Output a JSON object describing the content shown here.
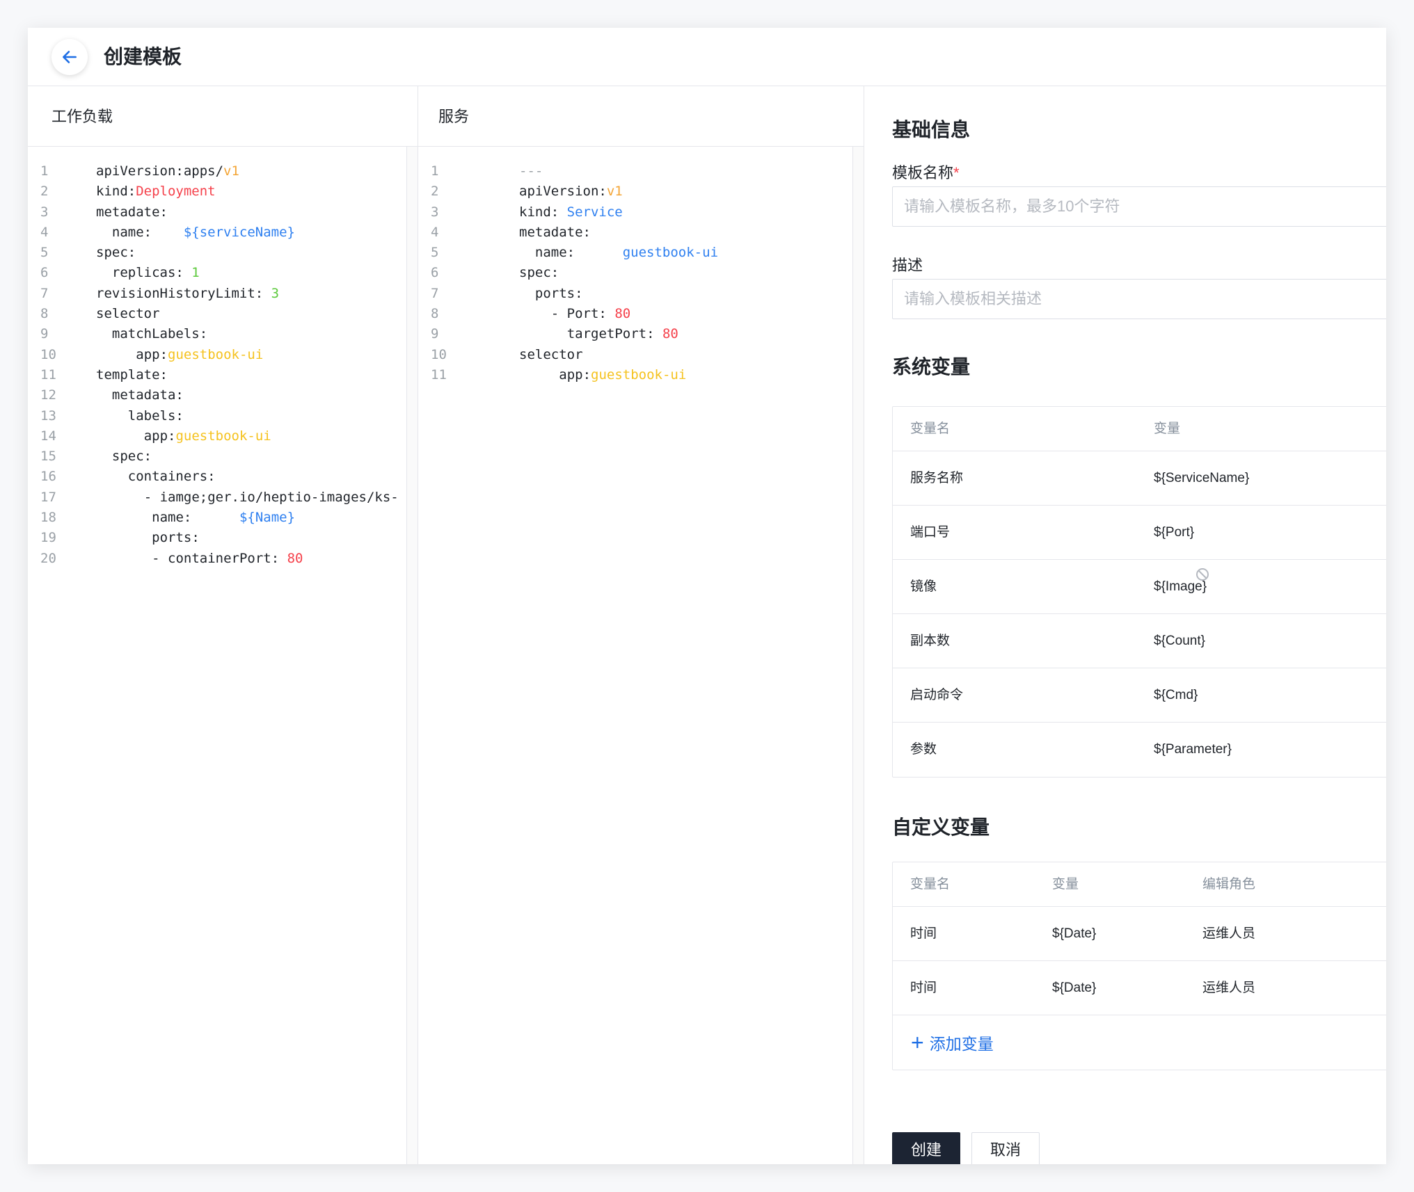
{
  "header": {
    "title": "创建模板"
  },
  "workload": {
    "title": "工作负载",
    "lines": [
      {
        "no": "1",
        "indent": 0,
        "parts": [
          {
            "t": "apiVersion:apps/"
          },
          {
            "t": "v1",
            "c": "orange"
          }
        ]
      },
      {
        "no": "2",
        "indent": 0,
        "parts": [
          {
            "t": "kind:"
          },
          {
            "t": "Deployment",
            "c": "red"
          }
        ]
      },
      {
        "no": "3",
        "indent": 0,
        "parts": [
          {
            "t": "metadate:"
          }
        ]
      },
      {
        "no": "4",
        "indent": 2,
        "parts": [
          {
            "t": "name:    "
          },
          {
            "t": "${serviceName}",
            "c": "blue"
          }
        ]
      },
      {
        "no": "5",
        "indent": 0,
        "parts": [
          {
            "t": "spec:"
          }
        ]
      },
      {
        "no": "6",
        "indent": 2,
        "parts": [
          {
            "t": "replicas: "
          },
          {
            "t": "1",
            "c": "green"
          }
        ]
      },
      {
        "no": "7",
        "indent": 0,
        "parts": [
          {
            "t": "revisionHistoryLimit: "
          },
          {
            "t": "3",
            "c": "green"
          }
        ]
      },
      {
        "no": "8",
        "indent": 0,
        "parts": [
          {
            "t": "selector"
          }
        ]
      },
      {
        "no": "9",
        "indent": 2,
        "parts": [
          {
            "t": "matchLabels:"
          }
        ]
      },
      {
        "no": "10",
        "indent": 5,
        "parts": [
          {
            "t": "app:"
          },
          {
            "t": "guestbook-ui",
            "c": "yellow"
          }
        ]
      },
      {
        "no": "11",
        "indent": 0,
        "parts": [
          {
            "t": "template:"
          }
        ]
      },
      {
        "no": "12",
        "indent": 2,
        "parts": [
          {
            "t": "metadata:"
          }
        ]
      },
      {
        "no": "13",
        "indent": 4,
        "parts": [
          {
            "t": "labels:"
          }
        ]
      },
      {
        "no": "14",
        "indent": 6,
        "parts": [
          {
            "t": "app:"
          },
          {
            "t": "guestbook-ui",
            "c": "yellow"
          }
        ]
      },
      {
        "no": "15",
        "indent": 2,
        "parts": [
          {
            "t": "spec:"
          }
        ]
      },
      {
        "no": "16",
        "indent": 4,
        "parts": [
          {
            "t": "containers:"
          }
        ]
      },
      {
        "no": "17",
        "indent": 6,
        "parts": [
          {
            "t": "- iamge;ger.io/heptio-images/ks-"
          }
        ]
      },
      {
        "no": "18",
        "indent": 7,
        "parts": [
          {
            "t": "name:      "
          },
          {
            "t": "${Name}",
            "c": "blue"
          }
        ]
      },
      {
        "no": "19",
        "indent": 7,
        "parts": [
          {
            "t": "ports:"
          }
        ]
      },
      {
        "no": "20",
        "indent": 7,
        "parts": [
          {
            "t": "- containerPort: "
          },
          {
            "t": "80",
            "c": "red"
          }
        ]
      }
    ]
  },
  "service": {
    "title": "服务",
    "lines": [
      {
        "no": "1",
        "indent": 0,
        "parts": [
          {
            "t": "---",
            "c": "gray"
          }
        ]
      },
      {
        "no": "2",
        "indent": 0,
        "parts": [
          {
            "t": "apiVersion:"
          },
          {
            "t": "v1",
            "c": "orange"
          }
        ]
      },
      {
        "no": "3",
        "indent": 0,
        "parts": [
          {
            "t": "kind: "
          },
          {
            "t": "Service",
            "c": "blue"
          }
        ]
      },
      {
        "no": "4",
        "indent": 0,
        "parts": [
          {
            "t": "metadate:"
          }
        ]
      },
      {
        "no": "5",
        "indent": 2,
        "parts": [
          {
            "t": "name:      "
          },
          {
            "t": "guestbook-ui",
            "c": "blue"
          }
        ]
      },
      {
        "no": "6",
        "indent": 0,
        "parts": [
          {
            "t": "spec:"
          }
        ]
      },
      {
        "no": "7",
        "indent": 2,
        "parts": [
          {
            "t": "ports:"
          }
        ]
      },
      {
        "no": "8",
        "indent": 4,
        "parts": [
          {
            "t": "- Port: "
          },
          {
            "t": "80",
            "c": "red"
          }
        ]
      },
      {
        "no": "9",
        "indent": 6,
        "parts": [
          {
            "t": "targetPort: "
          },
          {
            "t": "80",
            "c": "red"
          }
        ]
      },
      {
        "no": "10",
        "indent": 0,
        "parts": [
          {
            "t": "selector"
          }
        ]
      },
      {
        "no": "11",
        "indent": 5,
        "parts": [
          {
            "t": "app:"
          },
          {
            "t": "guestbook-ui",
            "c": "yellow"
          }
        ]
      }
    ]
  },
  "basic_info": {
    "title": "基础信息",
    "template_name_label": "模板名称",
    "required_mark": "*",
    "template_name_placeholder": "请输入模板名称，最多10个字符",
    "template_name_value": "",
    "description_label": "描述",
    "description_placeholder": "请输入模板相关描述",
    "description_value": ""
  },
  "system_vars": {
    "title": "系统变量",
    "columns": [
      "变量名",
      "变量"
    ],
    "rows": [
      [
        "服务名称",
        "${ServiceName}"
      ],
      [
        "端口号",
        "${Port}"
      ],
      [
        "镜像",
        "${Image}"
      ],
      [
        "副本数",
        "${Count}"
      ],
      [
        "启动命令",
        "${Cmd}"
      ],
      [
        "参数",
        "${Parameter}"
      ]
    ]
  },
  "custom_vars": {
    "title": "自定义变量",
    "columns": [
      "变量名",
      "变量",
      "编辑角色"
    ],
    "rows": [
      [
        "时间",
        "${Date}",
        "运维人员"
      ],
      [
        "时间",
        "${Date}",
        "运维人员"
      ]
    ],
    "add_label": "添加变量"
  },
  "actions": {
    "create_label": "创建",
    "cancel_label": "取消"
  },
  "colors": {
    "accent": "#1f6fe5",
    "primary_button": "#1c2433",
    "orange": "#f3a536",
    "red": "#f5414b",
    "blue": "#2f80f0",
    "green": "#5cc93c",
    "yellow": "#f5c21e"
  },
  "icons": {
    "back": "arrow-left-icon",
    "add": "plus-icon",
    "cursor": "not-allowed-cursor-icon"
  }
}
